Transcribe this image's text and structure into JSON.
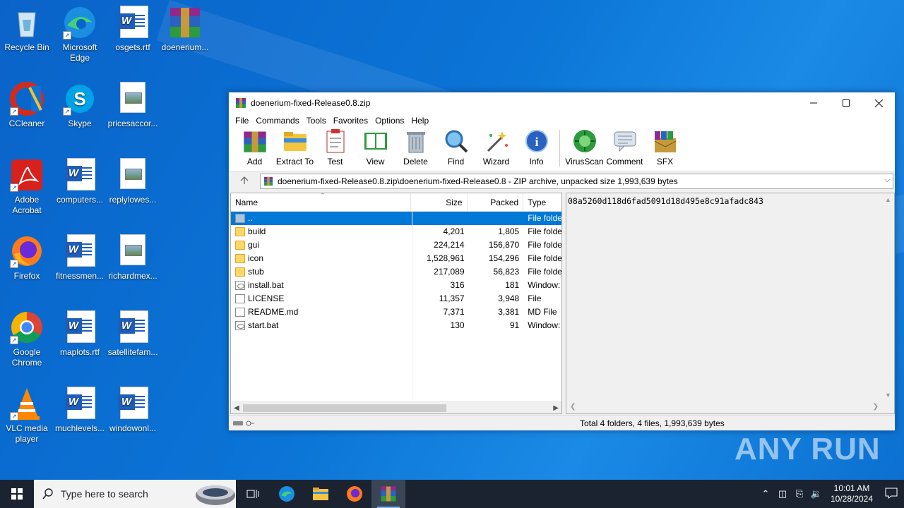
{
  "desktop": {
    "icons": [
      {
        "label": "Recycle Bin",
        "icon": "recycle-bin-icon"
      },
      {
        "label": "Microsoft Edge",
        "icon": "edge-icon"
      },
      {
        "label": "osgets.rtf",
        "icon": "word-doc-icon"
      },
      {
        "label": "doenerium...",
        "icon": "winrar-archive-icon"
      },
      {
        "label": "CCleaner",
        "icon": "ccleaner-icon"
      },
      {
        "label": "Skype",
        "icon": "skype-icon"
      },
      {
        "label": "pricesaccor...",
        "icon": "image-doc-icon"
      },
      {
        "label": "Adobe Acrobat",
        "icon": "acrobat-icon"
      },
      {
        "label": "computers...",
        "icon": "word-doc-icon"
      },
      {
        "label": "replylowes...",
        "icon": "image-doc-icon"
      },
      {
        "label": "Firefox",
        "icon": "firefox-icon"
      },
      {
        "label": "fitnessmen...",
        "icon": "word-doc-icon"
      },
      {
        "label": "richardmex...",
        "icon": "image-doc-icon"
      },
      {
        "label": "Google Chrome",
        "icon": "chrome-icon"
      },
      {
        "label": "maplots.rtf",
        "icon": "word-doc-icon"
      },
      {
        "label": "satellitefam...",
        "icon": "word-doc-icon"
      },
      {
        "label": "VLC media player",
        "icon": "vlc-icon"
      },
      {
        "label": "muchlevels...",
        "icon": "word-doc-icon"
      },
      {
        "label": "windowonl...",
        "icon": "word-doc-icon"
      }
    ]
  },
  "window": {
    "title": "doenerium-fixed-Release0.8.zip",
    "menu": [
      "File",
      "Commands",
      "Tools",
      "Favorites",
      "Options",
      "Help"
    ],
    "toolbar": [
      {
        "label": "Add",
        "icon": "add-icon"
      },
      {
        "label": "Extract To",
        "icon": "extract-folder-icon"
      },
      {
        "label": "Test",
        "icon": "test-clipboard-icon"
      },
      {
        "label": "View",
        "icon": "view-book-icon"
      },
      {
        "label": "Delete",
        "icon": "trash-icon"
      },
      {
        "label": "Find",
        "icon": "magnifier-icon"
      },
      {
        "label": "Wizard",
        "icon": "wizard-wand-icon"
      },
      {
        "label": "Info",
        "icon": "info-icon"
      },
      {
        "label": "VirusScan",
        "icon": "virus-scan-icon"
      },
      {
        "label": "Comment",
        "icon": "comment-icon"
      },
      {
        "label": "SFX",
        "icon": "sfx-icon"
      }
    ],
    "address": "doenerium-fixed-Release0.8.zip\\doenerium-fixed-Release0.8 - ZIP archive, unpacked size 1,993,639 bytes",
    "columns": {
      "name": "Name",
      "size": "Size",
      "packed": "Packed",
      "type": "Type"
    },
    "files": [
      {
        "name": "..",
        "size": "",
        "packed": "",
        "type": "File folde",
        "kind": "up",
        "selected": true
      },
      {
        "name": "build",
        "size": "4,201",
        "packed": "1,805",
        "type": "File folde",
        "kind": "folder"
      },
      {
        "name": "gui",
        "size": "224,214",
        "packed": "156,870",
        "type": "File folde",
        "kind": "folder"
      },
      {
        "name": "icon",
        "size": "1,528,961",
        "packed": "154,296",
        "type": "File folde",
        "kind": "folder"
      },
      {
        "name": "stub",
        "size": "217,089",
        "packed": "56,823",
        "type": "File folde",
        "kind": "folder"
      },
      {
        "name": "install.bat",
        "size": "316",
        "packed": "181",
        "type": "Window:",
        "kind": "bat"
      },
      {
        "name": "LICENSE",
        "size": "11,357",
        "packed": "3,948",
        "type": "File",
        "kind": "file"
      },
      {
        "name": "README.md",
        "size": "7,371",
        "packed": "3,381",
        "type": "MD File",
        "kind": "file"
      },
      {
        "name": "start.bat",
        "size": "130",
        "packed": "91",
        "type": "Window:",
        "kind": "bat"
      }
    ],
    "comment": "08a5260d118d6fad5091d18d495e8c91afadc843",
    "status": "Total 4 folders, 4 files, 1,993,639 bytes"
  },
  "taskbar": {
    "search_placeholder": "Type here to search",
    "time": "10:01 AM",
    "date": "10/28/2024"
  },
  "watermark": "ANY RUN"
}
